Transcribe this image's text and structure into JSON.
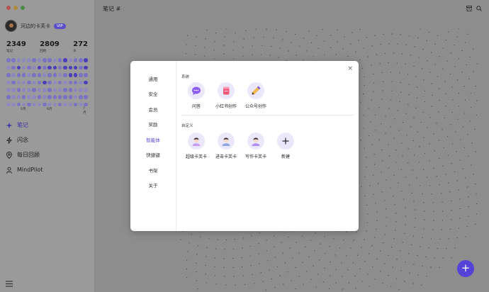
{
  "app": {
    "user_name": "河边的卡芙卡",
    "vip_label": "VIP",
    "stats": [
      {
        "value": "2349",
        "label": "笔记"
      },
      {
        "value": "2809",
        "label": "回顾"
      },
      {
        "value": "272",
        "label": "天"
      }
    ],
    "months": [
      "5月",
      "6月",
      "7月"
    ],
    "heatmap": [
      [
        2,
        2,
        1,
        1,
        1,
        2,
        1,
        2,
        2,
        1,
        2,
        3,
        1,
        2,
        2,
        3
      ],
      [
        1,
        2,
        3,
        1,
        2,
        1,
        3,
        2,
        3,
        3,
        2,
        3,
        3,
        3,
        2,
        3
      ],
      [
        2,
        1,
        2,
        2,
        1,
        2,
        2,
        1,
        2,
        2,
        1,
        2,
        3,
        3,
        2,
        2
      ],
      [
        1,
        2,
        1,
        1,
        2,
        1,
        2,
        3,
        2,
        1,
        2,
        1,
        2,
        2,
        1,
        3
      ],
      [
        1,
        1,
        2,
        1,
        1,
        2,
        1,
        1,
        2,
        1,
        1,
        2,
        2,
        1,
        1,
        1
      ],
      [
        2,
        1,
        1,
        2,
        1,
        1,
        2,
        1,
        2,
        2,
        2,
        2,
        2,
        1,
        2,
        2
      ],
      [
        1,
        1,
        2,
        1,
        2,
        1,
        1,
        2,
        1,
        1,
        2,
        1,
        1,
        2,
        1,
        2
      ]
    ],
    "heat_colors": {
      "0": "#9a9a9a",
      "1": "#8e89bd",
      "2": "#7a72c2",
      "3": "#4a3fb8"
    },
    "nav": [
      {
        "label": "笔记",
        "icon": "notes-icon",
        "active": true
      },
      {
        "label": "闪念",
        "icon": "flash-icon",
        "active": false
      },
      {
        "label": "每日回顾",
        "icon": "location-icon",
        "active": false
      },
      {
        "label": "MindPilot",
        "icon": "user-icon",
        "active": false
      }
    ],
    "page_title": "笔记 #",
    "fab_label": "+"
  },
  "modal": {
    "nav_items": [
      {
        "label": "通用",
        "active": false
      },
      {
        "label": "安全",
        "active": false
      },
      {
        "label": "会员",
        "active": false
      },
      {
        "label": "奖励",
        "active": false
      },
      {
        "label": "智能体",
        "active": true
      },
      {
        "label": "快捷键",
        "active": false
      },
      {
        "label": "书架",
        "active": false
      },
      {
        "label": "关于",
        "active": false
      }
    ],
    "close_label": "×",
    "system_label": "系统",
    "system_agents": [
      {
        "label": "问答",
        "icon": "chat-bubble-icon"
      },
      {
        "label": "小红书创作",
        "icon": "red-book-icon"
      },
      {
        "label": "公众号创作",
        "icon": "pencil-icon"
      }
    ],
    "custom_label": "自定义",
    "custom_agents": [
      {
        "label": "超级卡芙卡",
        "icon": "avatar-icon"
      },
      {
        "label": "进击卡芙卡",
        "icon": "avatar-icon"
      },
      {
        "label": "写作卡芙卡",
        "icon": "avatar-icon"
      },
      {
        "label": "新建",
        "icon": "plus-icon"
      }
    ]
  },
  "colors": {
    "accent": "#5443d6",
    "overlay": "#8d8d8d",
    "agent_bg": "#ece8fb"
  }
}
